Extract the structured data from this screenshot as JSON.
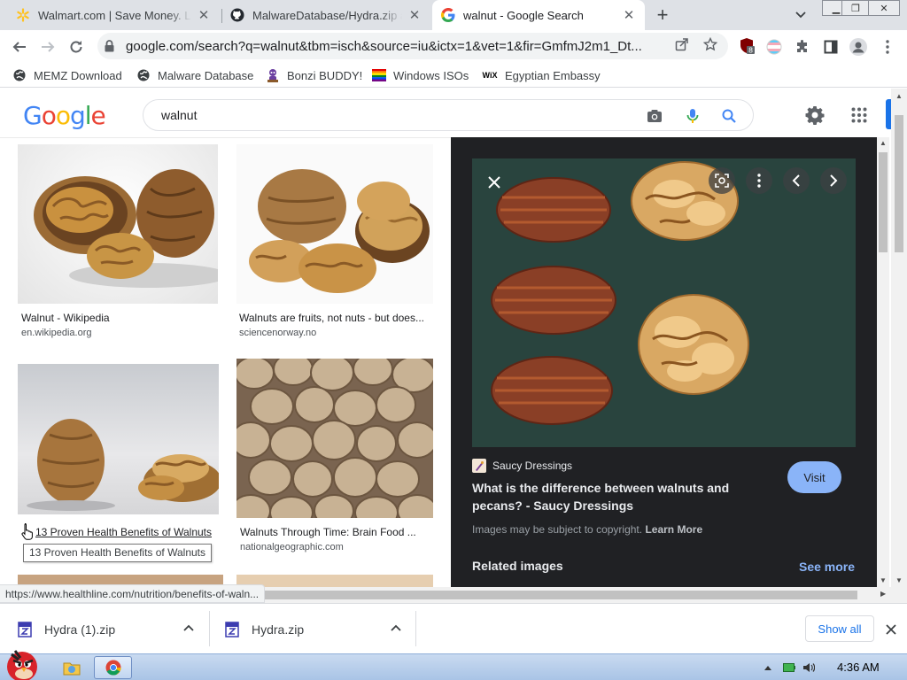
{
  "tabs": [
    {
      "title": "Walmart.com | Save Money. Live Better.",
      "favicon": "walmart-spark-icon"
    },
    {
      "title": "MalwareDatabase/Hydra.zip at main",
      "favicon": "github-icon"
    },
    {
      "title": "walnut - Google Search",
      "favicon": "google-icon",
      "active": true
    }
  ],
  "window_controls": {
    "minimize": "▁",
    "restore": "❐",
    "close": "✕"
  },
  "toolbar": {
    "url_host": "google.com",
    "url_path": "/search?q=walnut&tbm=isch&source=iu&ictx=1&vet=1&fir=GmfmJ2m1_Dt...",
    "extension_badge": "8"
  },
  "bookmarks": [
    {
      "label": "MEMZ Download",
      "icon": "globe-icon"
    },
    {
      "label": "Malware Database",
      "icon": "globe-icon"
    },
    {
      "label": "Bonzi BUDDY!",
      "icon": "bonzi-icon"
    },
    {
      "label": "Windows ISOs",
      "icon": "rainbow-flag-icon"
    },
    {
      "label": "Egyptian Embassy",
      "icon": "wix-icon"
    }
  ],
  "google": {
    "logo": [
      "G",
      "o",
      "o",
      "g",
      "l",
      "e"
    ],
    "logo_colors": [
      "#4285f4",
      "#ea4335",
      "#fbbc05",
      "#4285f4",
      "#34a853",
      "#ea4335"
    ],
    "query": "walnut"
  },
  "results": [
    {
      "caption": "Walnut - Wikipedia",
      "source": "en.wikipedia.org"
    },
    {
      "caption": "Walnuts are fruits, not nuts - but does...",
      "source": "sciencenorway.no"
    },
    {
      "caption": "13 Proven Health Benefits of Walnuts",
      "source": ""
    },
    {
      "caption": "Walnuts Through Time: Brain Food ...",
      "source": "nationalgeographic.com"
    }
  ],
  "tooltip": "13 Proven Health Benefits of Walnuts",
  "status_url": "https://www.healthline.com/nutrition/benefits-of-waln...",
  "panel": {
    "site_name": "Saucy Dressings",
    "title": "What is the difference between walnuts and pecans? - Saucy Dressings",
    "visit_label": "Visit",
    "copyright_text": "Images may be subject to copyright.",
    "learn_more": "Learn More",
    "related_label": "Related images",
    "see_more": "See more"
  },
  "downloads": [
    {
      "name": "Hydra (1).zip"
    },
    {
      "name": "Hydra.zip"
    }
  ],
  "shelf": {
    "show_all": "Show all"
  },
  "taskbar": {
    "time": "4:36 AM"
  },
  "colors": {
    "accent_blue": "#1a73e8",
    "panel_bg": "#202124",
    "visit_bg": "#8ab4f8"
  }
}
